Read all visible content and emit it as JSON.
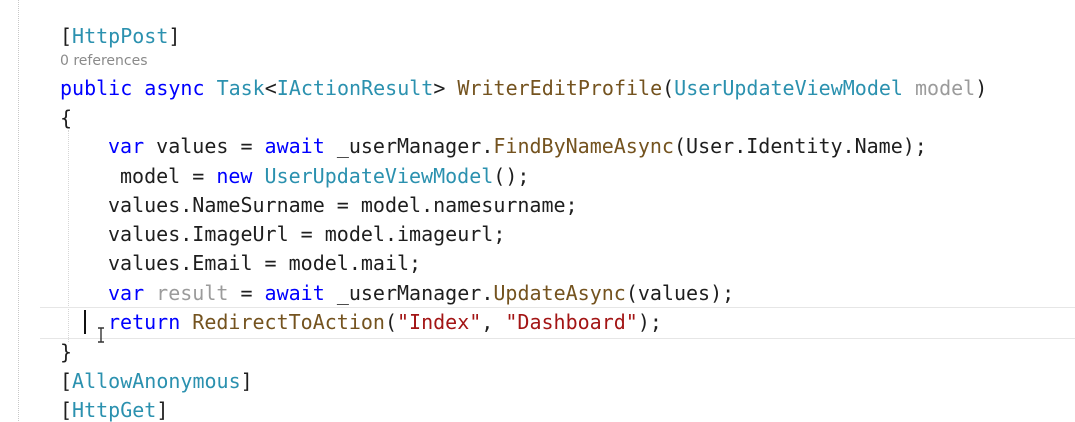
{
  "editor": {
    "codelens": "0 references",
    "lines": [
      "[HttpPost]",
      "public async Task<IActionResult> WriterEditProfile(UserUpdateViewModel model)",
      "{",
      "    var values = await _userManager.FindByNameAsync(User.Identity.Name);",
      "     model = new UserUpdateViewModel();",
      "    values.NameSurname = model.namesurname;",
      "    values.ImageUrl = model.imageurl;",
      "    values.Email = model.mail;",
      "    var result = await _userManager.UpdateAsync(values);",
      "    return RedirectToAction(\"Index\", \"Dashboard\");",
      "}",
      "[AllowAnonymous]",
      "[HttpGet]"
    ],
    "tokens": {
      "httppost": "HttpPost",
      "allowanonymous": "AllowAnonymous",
      "httpget": "HttpGet",
      "public": "public",
      "async": "async",
      "task": "Task",
      "iactionresult": "IActionResult",
      "method": "WriterEditProfile",
      "param_type": "UserUpdateViewModel",
      "param_name": "model",
      "var": "var",
      "await": "await",
      "new": "new",
      "return": "return",
      "findbyname": "FindByNameAsync",
      "updateasync": "UpdateAsync",
      "redirect": "RedirectToAction",
      "usermanager": "_userManager",
      "str_index": "\"Index\"",
      "str_dashboard": "\"Dashboard\""
    }
  },
  "colors": {
    "keyword": "#0000ff",
    "type": "#2b91af",
    "method": "#74531f",
    "string": "#a31515"
  }
}
